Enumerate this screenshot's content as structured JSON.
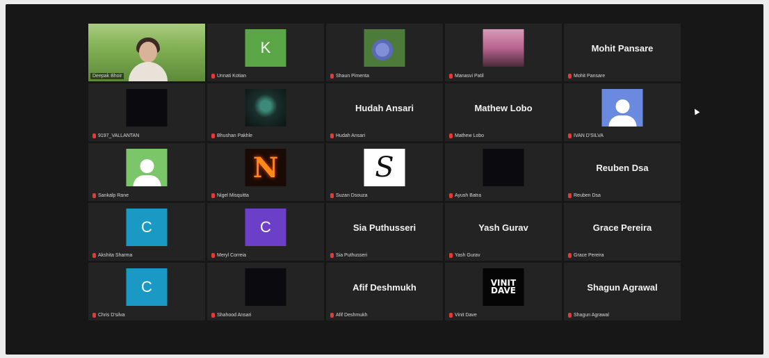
{
  "tiles": [
    {
      "type": "video",
      "label": "Deepak Bhoir",
      "active": true
    },
    {
      "type": "letter",
      "letter": "K",
      "color": "#5aa646",
      "label": "Unnati Kotian"
    },
    {
      "type": "photo",
      "photo": "flowers",
      "label": "Shaun Pimenta"
    },
    {
      "type": "photo",
      "photo": "sunset",
      "label": "Manasvi Patil"
    },
    {
      "type": "name",
      "name": "Mohit Pansare",
      "label": "Mohit Pansare"
    },
    {
      "type": "black",
      "label": "9197_VALLANTAN"
    },
    {
      "type": "photo",
      "photo": "dark-art",
      "label": "Bhushan Pakhle"
    },
    {
      "type": "name",
      "name": "Hudah Ansari",
      "label": "Hudah Ansari"
    },
    {
      "type": "name",
      "name": "Mathew Lobo",
      "label": "Mathew Lobo"
    },
    {
      "type": "avatar",
      "color": "#6a8ae0",
      "label": "IVAN D'SILVA"
    },
    {
      "type": "avatar",
      "color": "#7cc66a",
      "label": "Sankalp Rane"
    },
    {
      "type": "photo",
      "photo": "fire-n",
      "label": "Nigel Misquitta"
    },
    {
      "type": "photo",
      "photo": "script-s",
      "label": "Suzan Dsouza"
    },
    {
      "type": "black",
      "label": "Ayush Batra"
    },
    {
      "type": "name",
      "name": "Reuben Dsa",
      "label": "Reuben Dsa"
    },
    {
      "type": "letter",
      "letter": "C",
      "color": "#1a99c4",
      "label": "Akshita Sharma"
    },
    {
      "type": "letter",
      "letter": "C",
      "color": "#6b3fc7",
      "label": "Meryl Correia"
    },
    {
      "type": "name",
      "name": "Sia Puthusseri",
      "label": "Sia Puthusseri"
    },
    {
      "type": "name",
      "name": "Yash Gurav",
      "label": "Yash Gurav"
    },
    {
      "type": "name",
      "name": "Grace Pereira",
      "label": "Grace Pereira"
    },
    {
      "type": "letter",
      "letter": "C",
      "color": "#1a99c4",
      "label": "Chris D'silva"
    },
    {
      "type": "black",
      "label": "Shahood Ansari"
    },
    {
      "type": "name",
      "name": "Afif Deshmukh",
      "label": "Afif Deshmukh"
    },
    {
      "type": "photo",
      "photo": "logo-vinit",
      "label": "Vinit Dave"
    },
    {
      "type": "name",
      "name": "Shagun Agrawal",
      "label": "Shagun Agrawal"
    }
  ]
}
